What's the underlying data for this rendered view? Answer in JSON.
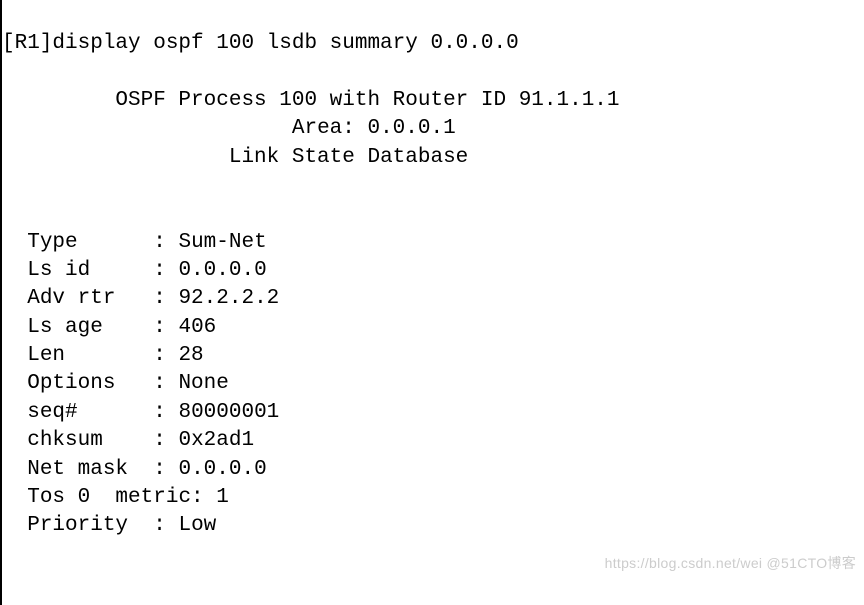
{
  "prompt": "[R1]display ospf 100 lsdb summary 0.0.0.0",
  "header": {
    "process_line": "OSPF Process 100 with Router ID 91.1.1.1",
    "area_line": "Area: 0.0.0.1",
    "lsdb_line": "Link State Database"
  },
  "fields": {
    "type": {
      "label": "Type",
      "value": "Sum-Net"
    },
    "ls_id": {
      "label": "Ls id",
      "value": "0.0.0.0"
    },
    "adv_rtr": {
      "label": "Adv rtr",
      "value": "92.2.2.2"
    },
    "ls_age": {
      "label": "Ls age",
      "value": "406"
    },
    "len": {
      "label": "Len",
      "value": "28"
    },
    "options": {
      "label": "Options",
      "value": "None"
    },
    "seq": {
      "label": "seq#",
      "value": "80000001"
    },
    "chksum": {
      "label": "chksum",
      "value": "0x2ad1"
    },
    "net_mask": {
      "label": "Net mask",
      "value": "0.0.0.0"
    },
    "tos": {
      "label": "Tos 0  metric",
      "value": "1"
    },
    "priority": {
      "label": "Priority",
      "value": "Low"
    }
  },
  "watermark": "https://blog.csdn.net/wei @51CTO博客"
}
